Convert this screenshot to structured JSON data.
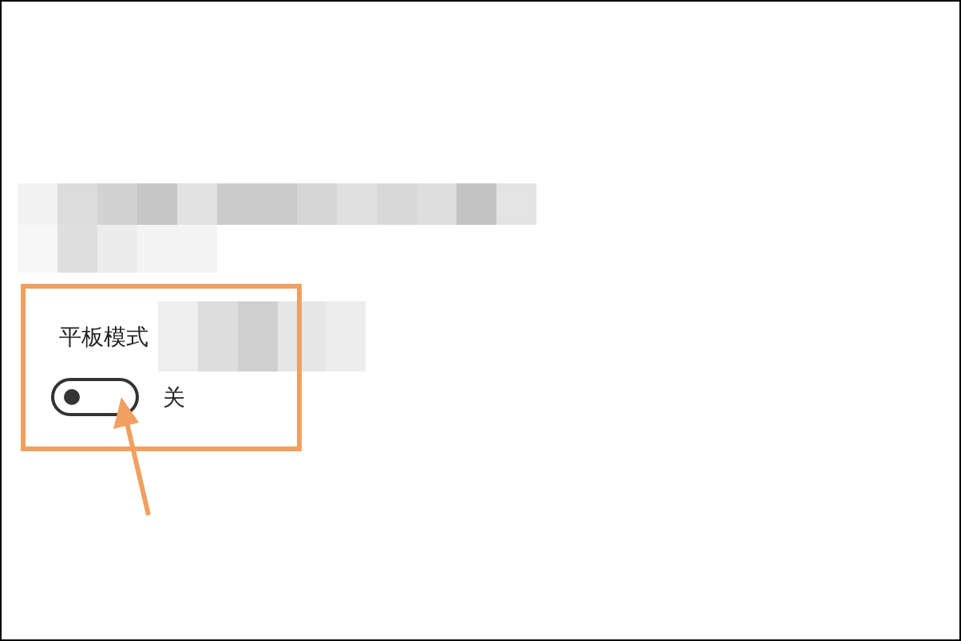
{
  "setting": {
    "label": "平板模式",
    "toggle": {
      "on": false
    },
    "state_text": "关"
  }
}
